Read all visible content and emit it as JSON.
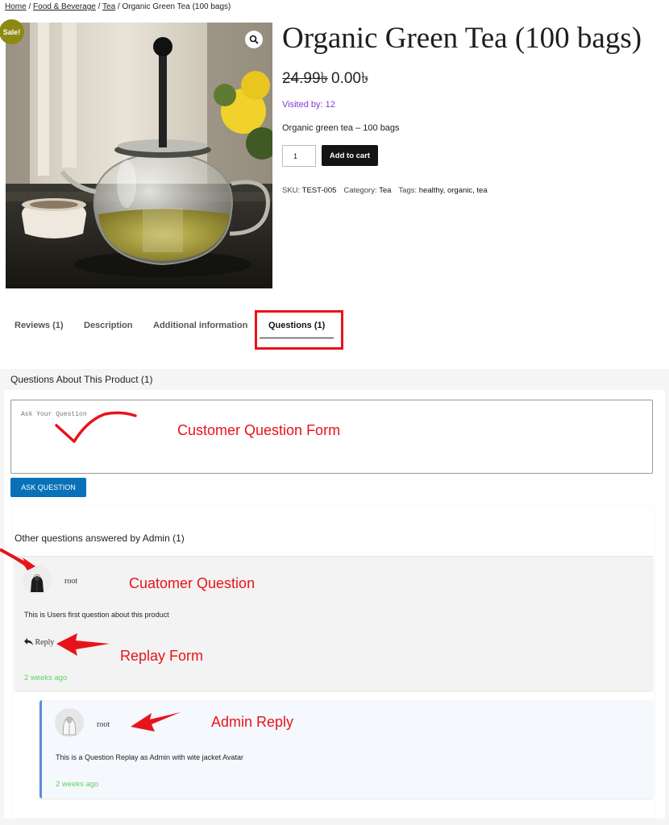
{
  "breadcrumb": {
    "home": "Home",
    "sep1": " / ",
    "category": "Food & Beverage",
    "sep2": " / ",
    "subcategory": "Tea",
    "sep3": " / ",
    "current": "Organic Green Tea (100 bags)"
  },
  "product": {
    "sale_badge": "Sale!",
    "zoom_icon": "magnifier-icon",
    "title": "Organic Green Tea (100 bags)",
    "price_old": "24.99৳",
    "price_new": "0.00৳",
    "visited": "Visited by: 12",
    "short_description": "Organic green tea – 100 bags",
    "quantity": "1",
    "add_to_cart": "Add to cart",
    "sku_label": "SKU: ",
    "sku_value": "TEST-005",
    "category_label": "Category: ",
    "category_value": "Tea",
    "tags_label": "Tags: ",
    "tags_value": "healthy, organic, tea"
  },
  "tabs": [
    {
      "label": "Reviews (1)"
    },
    {
      "label": "Description"
    },
    {
      "label": "Additional information"
    },
    {
      "label": "Questions (1)",
      "active": true
    }
  ],
  "questions": {
    "heading": "Questions About This Product (1)",
    "placeholder": "Ask Your Question",
    "ask_button": "ASK QUESTION",
    "answered_heading": "Other questions answered by Admin (1)",
    "question": {
      "author": "root",
      "text": "This is Users first question about this product",
      "reply_label": "Reply",
      "reply_icon": "reply-arrow-icon",
      "time": "2 weeks ago"
    },
    "answer": {
      "author": "root",
      "text": "This is a Question Replay as Admin with wite jacket Avatar",
      "time": "2 weeks ago"
    }
  },
  "annotations": {
    "form": "Customer Question Form",
    "customer_question": "Cuatomer Question",
    "reply_form": "Replay Form",
    "admin_reply": "Admin Reply"
  },
  "colors": {
    "annotation_red": "#e8131a",
    "ask_button_blue": "#0971b8",
    "visited_purple": "#7e3bd0",
    "time_green": "#5dd55d",
    "sale_badge": "#8c8a10"
  }
}
